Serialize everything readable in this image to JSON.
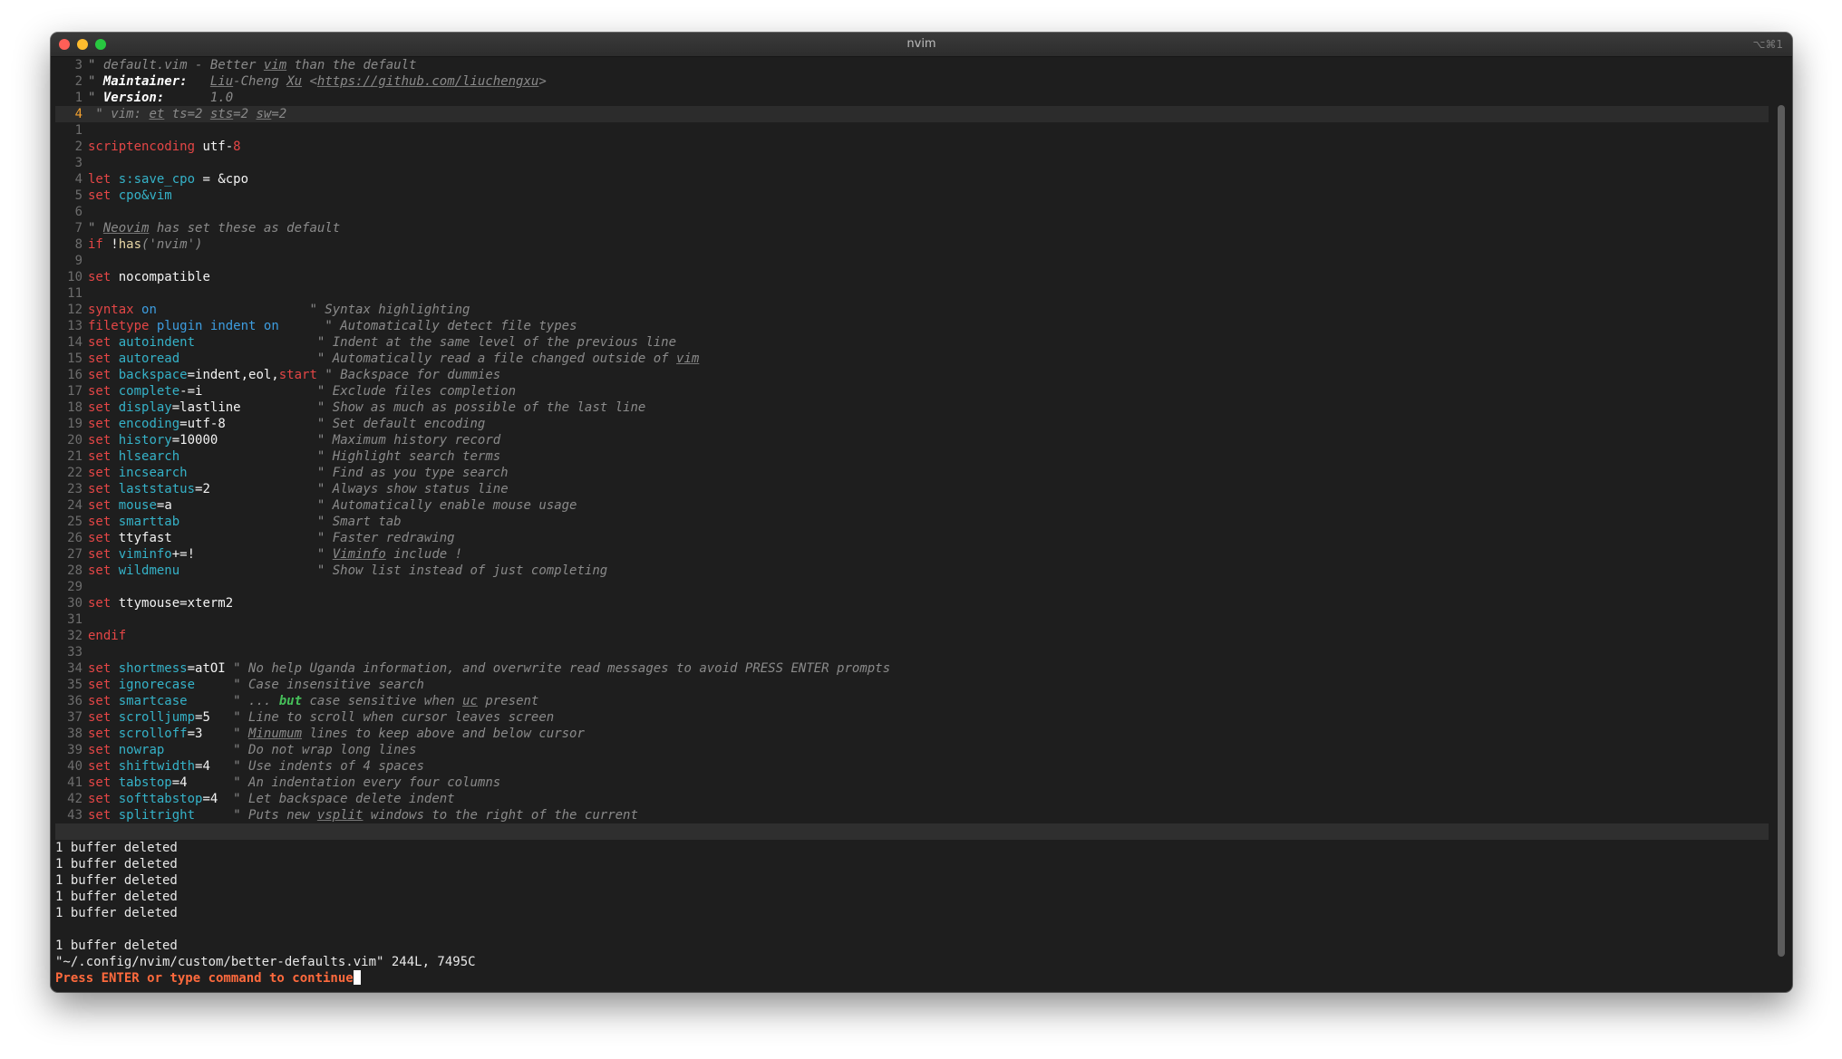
{
  "window": {
    "title": "nvim",
    "shortcut": "⌥⌘1"
  },
  "editor": {
    "lines": [
      {
        "n": "3",
        "segs": [
          {
            "t": "\" default.vim - Better ",
            "c": "c"
          },
          {
            "t": "vim",
            "c": "c u"
          },
          {
            "t": " than the default",
            "c": "c"
          }
        ]
      },
      {
        "n": "2",
        "segs": [
          {
            "t": "\" ",
            "c": "c"
          },
          {
            "t": "Maintainer:",
            "c": "cb"
          },
          {
            "t": "   ",
            "c": "c"
          },
          {
            "t": "Liu",
            "c": "c u"
          },
          {
            "t": "-Cheng ",
            "c": "c"
          },
          {
            "t": "Xu",
            "c": "c u"
          },
          {
            "t": " <",
            "c": "c"
          },
          {
            "t": "https://github.com/liuchengxu",
            "c": "c u"
          },
          {
            "t": ">",
            "c": "c"
          }
        ]
      },
      {
        "n": "1",
        "segs": [
          {
            "t": "\" ",
            "c": "c"
          },
          {
            "t": "Version:",
            "c": "cb"
          },
          {
            "t": "      1.0",
            "c": "c"
          }
        ]
      },
      {
        "n": "4",
        "current": true,
        "segs": [
          {
            "t": " \" vim: ",
            "c": "c"
          },
          {
            "t": "et",
            "c": "c u"
          },
          {
            "t": " ts=2 ",
            "c": "c"
          },
          {
            "t": "sts",
            "c": "c u"
          },
          {
            "t": "=2 ",
            "c": "c"
          },
          {
            "t": "sw",
            "c": "c u"
          },
          {
            "t": "=2",
            "c": "c"
          }
        ]
      },
      {
        "n": "1",
        "segs": []
      },
      {
        "n": "2",
        "segs": [
          {
            "t": "scriptencoding",
            "c": "kw"
          },
          {
            "t": " utf-",
            "c": "v"
          },
          {
            "t": "8",
            "c": "red"
          }
        ]
      },
      {
        "n": "3",
        "segs": []
      },
      {
        "n": "4",
        "segs": [
          {
            "t": "let",
            "c": "kw"
          },
          {
            "t": " ",
            "c": "v"
          },
          {
            "t": "s:save_cpo",
            "c": "op"
          },
          {
            "t": " = &cpo",
            "c": "v"
          }
        ]
      },
      {
        "n": "5",
        "segs": [
          {
            "t": "set",
            "c": "kw"
          },
          {
            "t": " ",
            "c": "v"
          },
          {
            "t": "cpo&vim",
            "c": "op"
          }
        ]
      },
      {
        "n": "6",
        "segs": []
      },
      {
        "n": "7",
        "segs": [
          {
            "t": "\" ",
            "c": "c"
          },
          {
            "t": "Neovim",
            "c": "c u"
          },
          {
            "t": " has set these as default",
            "c": "c"
          }
        ]
      },
      {
        "n": "8",
        "segs": [
          {
            "t": "if",
            "c": "kw"
          },
          {
            "t": " !",
            "c": "v"
          },
          {
            "t": "has",
            "c": "str"
          },
          {
            "t": "('nvim')",
            "c": "c"
          }
        ]
      },
      {
        "n": "9",
        "segs": []
      },
      {
        "n": "10",
        "segs": [
          {
            "t": "set",
            "c": "kw"
          },
          {
            "t": " nocompatible",
            "c": "v"
          }
        ]
      },
      {
        "n": "11",
        "segs": []
      },
      {
        "n": "12",
        "segs": [
          {
            "t": "syntax",
            "c": "kw"
          },
          {
            "t": " ",
            "c": "v"
          },
          {
            "t": "on",
            "c": "blue"
          },
          {
            "t": "                    ",
            "c": "v"
          },
          {
            "t": "\" Syntax highlighting",
            "c": "c"
          }
        ]
      },
      {
        "n": "13",
        "segs": [
          {
            "t": "filetype",
            "c": "kw"
          },
          {
            "t": " ",
            "c": "v"
          },
          {
            "t": "plugin",
            "c": "blue"
          },
          {
            "t": " ",
            "c": "v"
          },
          {
            "t": "indent",
            "c": "blue"
          },
          {
            "t": " ",
            "c": "v"
          },
          {
            "t": "on",
            "c": "blue"
          },
          {
            "t": "      ",
            "c": "v"
          },
          {
            "t": "\" Automatically detect file types",
            "c": "c"
          }
        ]
      },
      {
        "n": "14",
        "segs": [
          {
            "t": "set",
            "c": "kw"
          },
          {
            "t": " ",
            "c": "v"
          },
          {
            "t": "autoindent",
            "c": "op"
          },
          {
            "t": "                ",
            "c": "v"
          },
          {
            "t": "\" Indent at the same level of the previous line",
            "c": "c"
          }
        ]
      },
      {
        "n": "15",
        "segs": [
          {
            "t": "set",
            "c": "kw"
          },
          {
            "t": " ",
            "c": "v"
          },
          {
            "t": "autoread",
            "c": "op"
          },
          {
            "t": "                  ",
            "c": "v"
          },
          {
            "t": "\" Automatically read a file changed outside of ",
            "c": "c"
          },
          {
            "t": "vim",
            "c": "c u"
          }
        ]
      },
      {
        "n": "16",
        "segs": [
          {
            "t": "set",
            "c": "kw"
          },
          {
            "t": " ",
            "c": "v"
          },
          {
            "t": "backspace",
            "c": "op"
          },
          {
            "t": "=indent,eol,",
            "c": "v"
          },
          {
            "t": "start",
            "c": "red"
          },
          {
            "t": " ",
            "c": "v"
          },
          {
            "t": "\" Backspace for dummies",
            "c": "c"
          }
        ]
      },
      {
        "n": "17",
        "segs": [
          {
            "t": "set",
            "c": "kw"
          },
          {
            "t": " ",
            "c": "v"
          },
          {
            "t": "complete",
            "c": "op"
          },
          {
            "t": "-=i",
            "c": "v"
          },
          {
            "t": "               ",
            "c": "v"
          },
          {
            "t": "\" Exclude files completion",
            "c": "c"
          }
        ]
      },
      {
        "n": "18",
        "segs": [
          {
            "t": "set",
            "c": "kw"
          },
          {
            "t": " ",
            "c": "v"
          },
          {
            "t": "display",
            "c": "op"
          },
          {
            "t": "=lastline",
            "c": "v"
          },
          {
            "t": "          ",
            "c": "v"
          },
          {
            "t": "\" Show as much as possible of the last line",
            "c": "c"
          }
        ]
      },
      {
        "n": "19",
        "segs": [
          {
            "t": "set",
            "c": "kw"
          },
          {
            "t": " ",
            "c": "v"
          },
          {
            "t": "encoding",
            "c": "op"
          },
          {
            "t": "=utf-8",
            "c": "v"
          },
          {
            "t": "            ",
            "c": "v"
          },
          {
            "t": "\" Set default encoding",
            "c": "c"
          }
        ]
      },
      {
        "n": "20",
        "segs": [
          {
            "t": "set",
            "c": "kw"
          },
          {
            "t": " ",
            "c": "v"
          },
          {
            "t": "history",
            "c": "op"
          },
          {
            "t": "=10000",
            "c": "v"
          },
          {
            "t": "             ",
            "c": "v"
          },
          {
            "t": "\" Maximum history record",
            "c": "c"
          }
        ]
      },
      {
        "n": "21",
        "segs": [
          {
            "t": "set",
            "c": "kw"
          },
          {
            "t": " ",
            "c": "v"
          },
          {
            "t": "hlsearch",
            "c": "op"
          },
          {
            "t": "                  ",
            "c": "v"
          },
          {
            "t": "\" Highlight search terms",
            "c": "c"
          }
        ]
      },
      {
        "n": "22",
        "segs": [
          {
            "t": "set",
            "c": "kw"
          },
          {
            "t": " ",
            "c": "v"
          },
          {
            "t": "incsearch",
            "c": "op"
          },
          {
            "t": "                 ",
            "c": "v"
          },
          {
            "t": "\" Find as you type search",
            "c": "c"
          }
        ]
      },
      {
        "n": "23",
        "segs": [
          {
            "t": "set",
            "c": "kw"
          },
          {
            "t": " ",
            "c": "v"
          },
          {
            "t": "laststatus",
            "c": "op"
          },
          {
            "t": "=2",
            "c": "v"
          },
          {
            "t": "              ",
            "c": "v"
          },
          {
            "t": "\" Always show status line",
            "c": "c"
          }
        ]
      },
      {
        "n": "24",
        "segs": [
          {
            "t": "set",
            "c": "kw"
          },
          {
            "t": " ",
            "c": "v"
          },
          {
            "t": "mouse",
            "c": "op"
          },
          {
            "t": "=a",
            "c": "v"
          },
          {
            "t": "                   ",
            "c": "v"
          },
          {
            "t": "\" Automatically enable mouse usage",
            "c": "c"
          }
        ]
      },
      {
        "n": "25",
        "segs": [
          {
            "t": "set",
            "c": "kw"
          },
          {
            "t": " ",
            "c": "v"
          },
          {
            "t": "smarttab",
            "c": "op"
          },
          {
            "t": "                  ",
            "c": "v"
          },
          {
            "t": "\" Smart tab",
            "c": "c"
          }
        ]
      },
      {
        "n": "26",
        "segs": [
          {
            "t": "set",
            "c": "kw"
          },
          {
            "t": " ttyfast",
            "c": "v"
          },
          {
            "t": "                   ",
            "c": "v"
          },
          {
            "t": "\" Faster redrawing",
            "c": "c"
          }
        ]
      },
      {
        "n": "27",
        "segs": [
          {
            "t": "set",
            "c": "kw"
          },
          {
            "t": " ",
            "c": "v"
          },
          {
            "t": "viminfo",
            "c": "op"
          },
          {
            "t": "+=!",
            "c": "v"
          },
          {
            "t": "                ",
            "c": "v"
          },
          {
            "t": "\" ",
            "c": "c"
          },
          {
            "t": "Viminfo",
            "c": "c u"
          },
          {
            "t": " include !",
            "c": "c"
          }
        ]
      },
      {
        "n": "28",
        "segs": [
          {
            "t": "set",
            "c": "kw"
          },
          {
            "t": " ",
            "c": "v"
          },
          {
            "t": "wildmenu",
            "c": "op"
          },
          {
            "t": "                  ",
            "c": "v"
          },
          {
            "t": "\" Show list instead of just completing",
            "c": "c"
          }
        ]
      },
      {
        "n": "29",
        "segs": []
      },
      {
        "n": "30",
        "segs": [
          {
            "t": "set",
            "c": "kw"
          },
          {
            "t": " ttymouse=xterm2",
            "c": "v"
          }
        ]
      },
      {
        "n": "31",
        "segs": []
      },
      {
        "n": "32",
        "segs": [
          {
            "t": "endif",
            "c": "kw"
          }
        ]
      },
      {
        "n": "33",
        "segs": []
      },
      {
        "n": "34",
        "segs": [
          {
            "t": "set",
            "c": "kw"
          },
          {
            "t": " ",
            "c": "v"
          },
          {
            "t": "shortmess",
            "c": "op"
          },
          {
            "t": "=atOI ",
            "c": "v"
          },
          {
            "t": "\" No help Uganda information, and overwrite read messages to avoid PRESS ENTER prompts",
            "c": "c"
          }
        ]
      },
      {
        "n": "35",
        "segs": [
          {
            "t": "set",
            "c": "kw"
          },
          {
            "t": " ",
            "c": "v"
          },
          {
            "t": "ignorecase",
            "c": "op"
          },
          {
            "t": "     ",
            "c": "v"
          },
          {
            "t": "\" Case insensitive search",
            "c": "c"
          }
        ]
      },
      {
        "n": "36",
        "segs": [
          {
            "t": "set",
            "c": "kw"
          },
          {
            "t": " ",
            "c": "v"
          },
          {
            "t": "smartcase",
            "c": "op"
          },
          {
            "t": "      ",
            "c": "v"
          },
          {
            "t": "\" ... ",
            "c": "c"
          },
          {
            "t": "but",
            "c": "green"
          },
          {
            "t": " case sensitive when ",
            "c": "c"
          },
          {
            "t": "uc",
            "c": "c u"
          },
          {
            "t": " present",
            "c": "c"
          }
        ]
      },
      {
        "n": "37",
        "segs": [
          {
            "t": "set",
            "c": "kw"
          },
          {
            "t": " ",
            "c": "v"
          },
          {
            "t": "scrolljump",
            "c": "op"
          },
          {
            "t": "=5",
            "c": "v"
          },
          {
            "t": "   ",
            "c": "v"
          },
          {
            "t": "\" Line to scroll when cursor leaves screen",
            "c": "c"
          }
        ]
      },
      {
        "n": "38",
        "segs": [
          {
            "t": "set",
            "c": "kw"
          },
          {
            "t": " ",
            "c": "v"
          },
          {
            "t": "scrolloff",
            "c": "op"
          },
          {
            "t": "=3",
            "c": "v"
          },
          {
            "t": "    ",
            "c": "v"
          },
          {
            "t": "\" ",
            "c": "c"
          },
          {
            "t": "Minumum",
            "c": "c u"
          },
          {
            "t": " lines to keep above and below cursor",
            "c": "c"
          }
        ]
      },
      {
        "n": "39",
        "segs": [
          {
            "t": "set",
            "c": "kw"
          },
          {
            "t": " ",
            "c": "v"
          },
          {
            "t": "nowrap",
            "c": "op"
          },
          {
            "t": "         ",
            "c": "v"
          },
          {
            "t": "\" Do not wrap long lines",
            "c": "c"
          }
        ]
      },
      {
        "n": "40",
        "segs": [
          {
            "t": "set",
            "c": "kw"
          },
          {
            "t": " ",
            "c": "v"
          },
          {
            "t": "shiftwidth",
            "c": "op"
          },
          {
            "t": "=4",
            "c": "v"
          },
          {
            "t": "   ",
            "c": "v"
          },
          {
            "t": "\" Use indents of 4 spaces",
            "c": "c"
          }
        ]
      },
      {
        "n": "41",
        "segs": [
          {
            "t": "set",
            "c": "kw"
          },
          {
            "t": " ",
            "c": "v"
          },
          {
            "t": "tabstop",
            "c": "op"
          },
          {
            "t": "=4",
            "c": "v"
          },
          {
            "t": "      ",
            "c": "v"
          },
          {
            "t": "\" An indentation every four columns",
            "c": "c"
          }
        ]
      },
      {
        "n": "42",
        "segs": [
          {
            "t": "set",
            "c": "kw"
          },
          {
            "t": " ",
            "c": "v"
          },
          {
            "t": "softtabstop",
            "c": "op"
          },
          {
            "t": "=4",
            "c": "v"
          },
          {
            "t": "  ",
            "c": "v"
          },
          {
            "t": "\" Let backspace delete indent",
            "c": "c"
          }
        ]
      },
      {
        "n": "43",
        "segs": [
          {
            "t": "set",
            "c": "kw"
          },
          {
            "t": " ",
            "c": "v"
          },
          {
            "t": "splitright",
            "c": "op"
          },
          {
            "t": "     ",
            "c": "v"
          },
          {
            "t": "\" Puts new ",
            "c": "c"
          },
          {
            "t": "vsplit",
            "c": "c u"
          },
          {
            "t": " windows to the right of the current",
            "c": "c"
          }
        ]
      }
    ]
  },
  "messages": [
    "1 buffer deleted",
    "1 buffer deleted",
    "1 buffer deleted",
    "1 buffer deleted",
    "1 buffer deleted",
    "",
    "1 buffer deleted",
    "\"~/.config/nvim/custom/better-defaults.vim\" 244L, 7495C"
  ],
  "prompt": "Press ENTER or type command to continue"
}
